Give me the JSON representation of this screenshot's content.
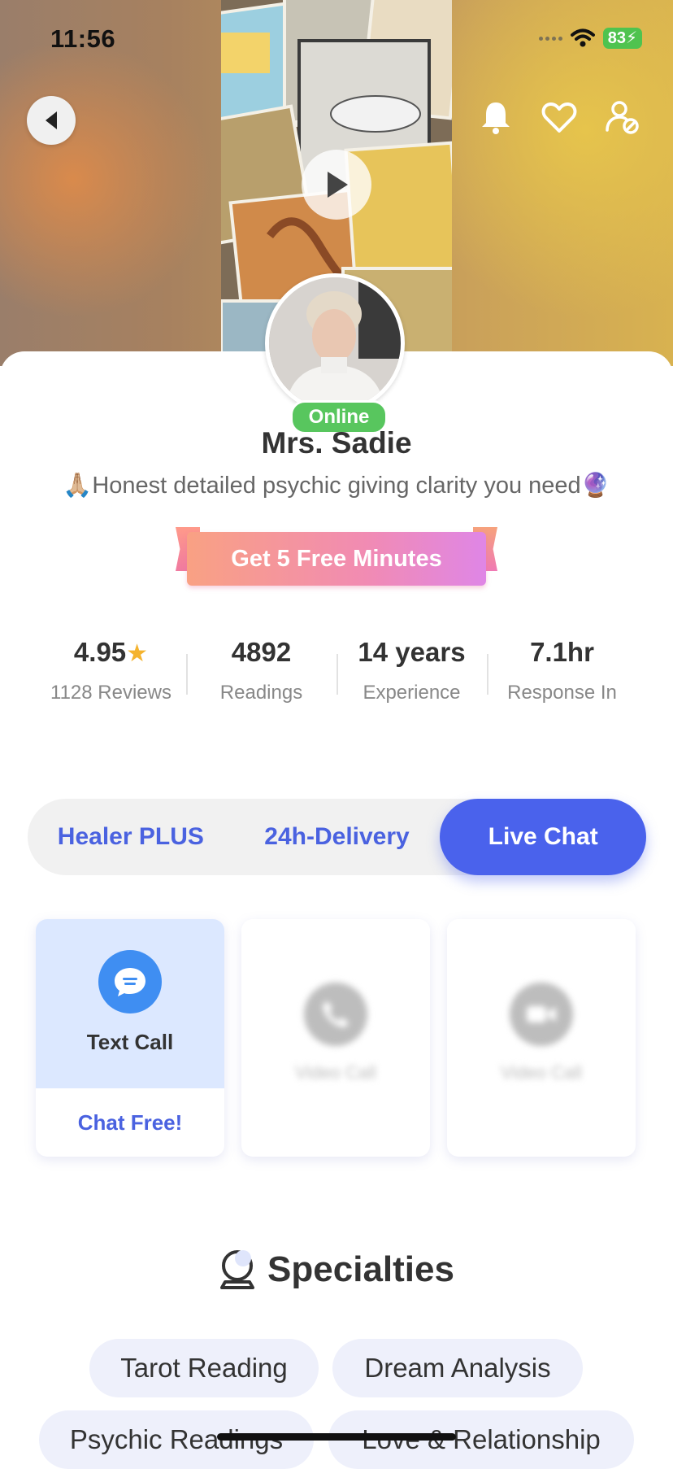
{
  "status_bar": {
    "time": "11:56",
    "battery": "83"
  },
  "header": {
    "icons": [
      "back-arrow-icon",
      "bell-icon",
      "heart-icon",
      "user-block-icon",
      "play-icon"
    ]
  },
  "profile": {
    "status": "Online",
    "name": "Mrs. Sadie",
    "tagline": "🙏🏼Honest detailed psychic giving clarity you need🔮",
    "promo_label": "Get 5 Free Minutes"
  },
  "stats": [
    {
      "value": "4.95",
      "label": "1128 Reviews",
      "icon": "star-icon"
    },
    {
      "value": "4892",
      "label": "Readings"
    },
    {
      "value": "14 years",
      "label": "Experience"
    },
    {
      "value": "7.1hr",
      "label": "Response In"
    }
  ],
  "tabs": [
    "Healer PLUS",
    "24h-Delivery",
    "Live Chat"
  ],
  "active_tab": "Live Chat",
  "services": [
    {
      "title": "Text Call",
      "action": "Chat Free!",
      "icon": "chat-bubble-icon"
    },
    {
      "title": "Video Call",
      "icon": "phone-icon"
    },
    {
      "title": "Video Call",
      "icon": "video-icon"
    }
  ],
  "specialties": {
    "title": "Specialties",
    "chips": [
      "Tarot Reading",
      "Dream Analysis",
      "Psychic Readings",
      "Love & Relationship"
    ]
  },
  "colors": {
    "accent": "#4a62ec",
    "online": "#58c65e",
    "promo_start": "#f9a183",
    "promo_end": "#df86e6",
    "star": "#f4b32e"
  }
}
